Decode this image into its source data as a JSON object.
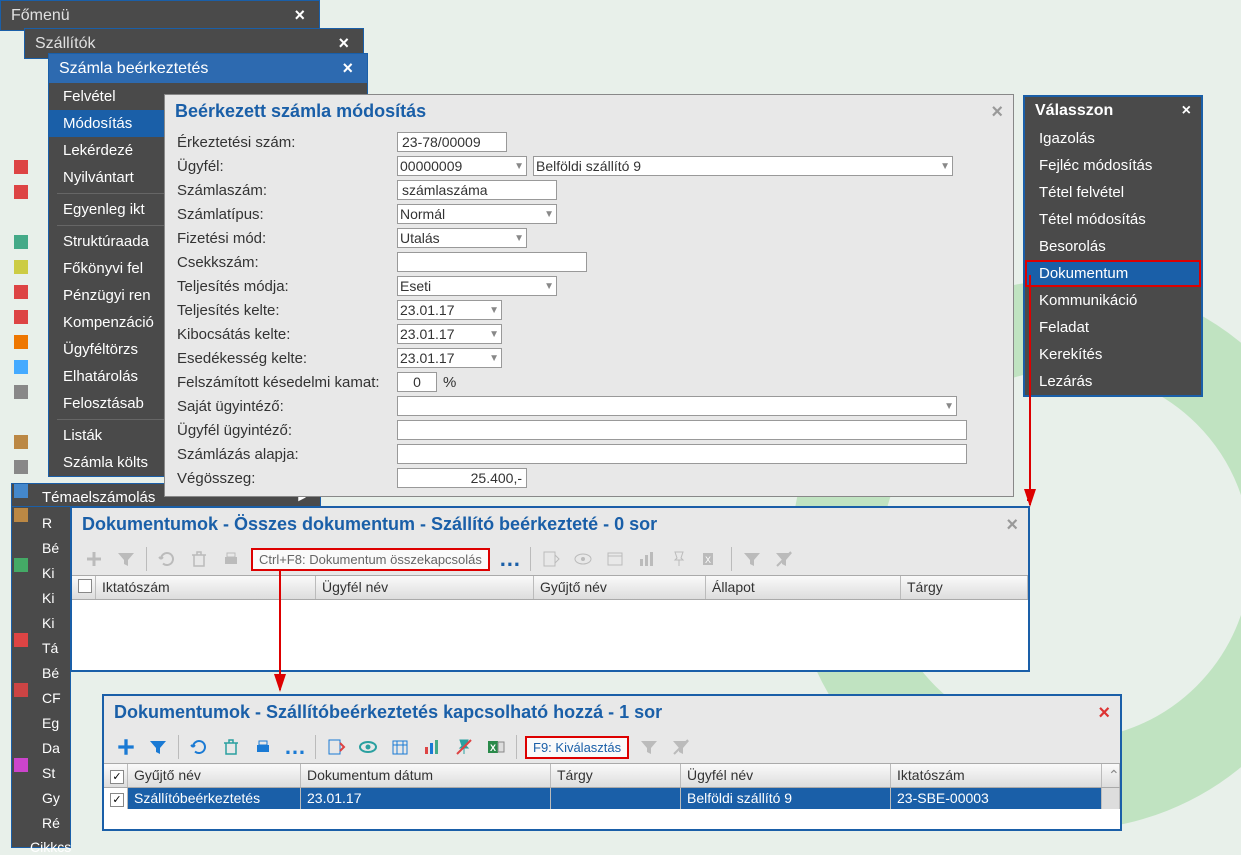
{
  "windows": {
    "main": {
      "title": "Főmenü"
    },
    "vendors": {
      "title": "Szállítók"
    },
    "invoice_entry": {
      "title": "Számla beérkeztetés"
    }
  },
  "submenu": {
    "items": [
      "Felvétel",
      "Módosítás",
      "Lekérdezé",
      "Nyilvántart"
    ],
    "selected": 1,
    "below": "Egyenleg ikt"
  },
  "left_menu": {
    "items": [
      "Struktúraada",
      "Főkönyvi fel",
      "Pénzügyi ren",
      "Kompenzáció",
      "Ügyféltörzs",
      "Elhatárolás",
      "Felosztásab"
    ],
    "lists": "Listák",
    "invoice_cost": "Számla költs",
    "topic": "Témaelszámolás",
    "partial": [
      "R",
      "Bé",
      "Ki",
      "Ki",
      "Ki",
      "Tá",
      "Bé",
      "CF",
      "Eg",
      "Da",
      "St",
      "Gy",
      "Ré",
      "Cikkcs"
    ]
  },
  "dialog_edit": {
    "title": "Beérkezett számla módosítás",
    "rows": {
      "erkszam": {
        "label": "Érkeztetési szám:",
        "value": "23-78/00009"
      },
      "ugyfel": {
        "label": "Ügyfél:",
        "code": "00000009",
        "name": "Belföldi szállító 9"
      },
      "szamlaszam": {
        "label": "Számlaszám:",
        "value": "számlaszáma"
      },
      "szamlatipus": {
        "label": "Számlatípus:",
        "value": "Normál"
      },
      "fizmod": {
        "label": "Fizetési mód:",
        "value": "Utalás"
      },
      "csekkszam": {
        "label": "Csekkszám:",
        "value": ""
      },
      "teljmod": {
        "label": "Teljesítés módja:",
        "value": "Eseti"
      },
      "teljkelte": {
        "label": "Teljesítés kelte:",
        "value": "23.01.17"
      },
      "kibkelte": {
        "label": "Kibocsátás kelte:",
        "value": "23.01.17"
      },
      "esedkelte": {
        "label": "Esedékesség kelte:",
        "value": "23.01.17"
      },
      "kamat": {
        "label": "Felszámított késedelmi kamat:",
        "value": "0",
        "unit": "%"
      },
      "sajat": {
        "label": "Saját ügyintéző:",
        "value": ""
      },
      "ugyfelu": {
        "label": "Ügyfél ügyintéző:",
        "value": ""
      },
      "szamlalap": {
        "label": "Számlázás alapja:",
        "value": ""
      },
      "vegosszeg": {
        "label": "Végösszeg:",
        "value": "25.400,-"
      }
    }
  },
  "valasszon": {
    "title": "Válasszon",
    "items": [
      "Igazolás",
      "Fejléc módosítás",
      "Tétel felvétel",
      "Tétel módosítás",
      "Besorolás",
      "Dokumentum",
      "Kommunikáció",
      "Feladat",
      "Kerekítés",
      "Lezárás"
    ],
    "selected": 5
  },
  "docs1": {
    "title": "Dokumentumok - Összes dokumentum - Szállító beérkezteté - 0 sor",
    "tooltip": "Ctrl+F8: Dokumentum összekapcsolás",
    "headers": [
      "Iktatószám",
      "Ügyfél név",
      "Gyűjtő név",
      "Állapot",
      "Tárgy"
    ]
  },
  "docs2": {
    "title": "Dokumentumok - Szállítóbeérkeztetés kapcsolható hozzá - 1 sor",
    "f9": "F9: Kiválasztás",
    "headers": [
      "Gyűjtő név",
      "Dokumentum dátum",
      "Tárgy",
      "Ügyfél név",
      "Iktatószám"
    ],
    "row": {
      "gyujto": "Szállítóbeérkeztetés",
      "datum": "23.01.17",
      "targy": "",
      "ugyfel": "Belföldi szállító 9",
      "iktato": "23-SBE-00003"
    }
  }
}
